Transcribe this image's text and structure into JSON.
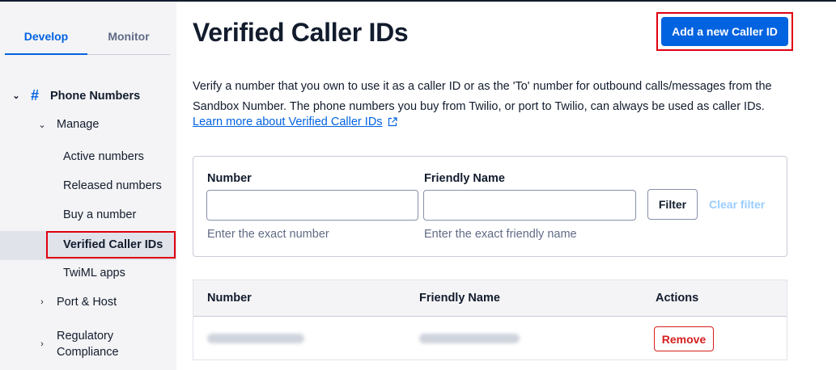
{
  "sidebar": {
    "tabs": [
      {
        "label": "Develop"
      },
      {
        "label": "Monitor"
      }
    ],
    "phone_numbers": "Phone Numbers",
    "manage": "Manage",
    "items": [
      {
        "label": "Active numbers"
      },
      {
        "label": "Released numbers"
      },
      {
        "label": "Buy a number"
      },
      {
        "label": "Verified Caller IDs"
      },
      {
        "label": "TwiML apps"
      }
    ],
    "port_host": "Port & Host",
    "regulatory_line1": "Regulatory",
    "regulatory_line2": "Compliance"
  },
  "main": {
    "title": "Verified Caller IDs",
    "add_button": "Add a new Caller ID",
    "description": "Verify a number that you own to use it as a caller ID or as the 'To' number for outbound calls/messages from the Sandbox Number. The phone numbers you buy from Twilio, or port to Twilio, can always be used as caller IDs.",
    "learn_more": "Learn more about Verified Caller IDs"
  },
  "filter": {
    "number_label": "Number",
    "number_value": "",
    "number_help": "Enter the exact number",
    "friendly_label": "Friendly Name",
    "friendly_value": "",
    "friendly_help": "Enter the exact friendly name",
    "filter_button": "Filter",
    "clear_button": "Clear filter"
  },
  "table": {
    "headers": [
      "Number",
      "Friendly Name",
      "Actions"
    ],
    "rows": [
      {
        "action": "Remove"
      }
    ]
  },
  "colors": {
    "accent": "#0263e0",
    "highlight_border": "#e00011",
    "danger": "#d61f1f"
  }
}
